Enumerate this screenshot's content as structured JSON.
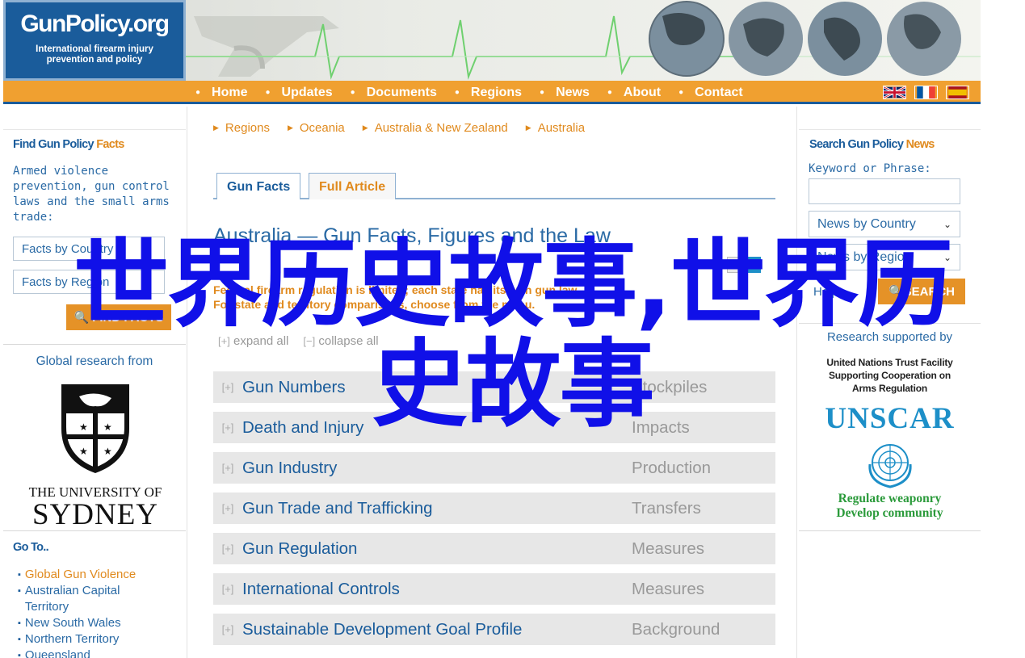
{
  "header": {
    "logo_title": "GunPolicy.org",
    "logo_tagline_1": "International firearm injury",
    "logo_tagline_2": "prevention and policy"
  },
  "nav": {
    "items": [
      "Home",
      "Updates",
      "Documents",
      "Regions",
      "News",
      "About",
      "Contact"
    ],
    "flags": [
      "uk-flag-icon",
      "france-flag-icon",
      "spain-flag-icon"
    ]
  },
  "left": {
    "find_heading_a": "Find Gun Policy",
    "find_heading_b": "Facts",
    "find_desc": "Armed violence prevention, gun control laws and the small arms trade:",
    "select_country": "Facts by Country",
    "select_region": "Facts by Region",
    "find_button": "FIND FACTS",
    "global_label": "Global research from",
    "usyd_line1": "THE UNIVERSITY OF",
    "usyd_line2": "SYDNEY",
    "goto_heading": "Go To..",
    "goto_items": [
      "Global Gun Violence",
      "Australian Capital Territory",
      "New South Wales",
      "Northern Territory",
      "Queensland"
    ]
  },
  "center": {
    "breadcrumb": [
      "Regions",
      "Oceania",
      "Australia & New Zealand",
      "Australia"
    ],
    "tabs": [
      "Gun Facts",
      "Full Article"
    ],
    "title": "Australia — Gun Facts, Figures and the Law",
    "warning_1": "Federal firearm regulation is limited; each state has its own gun law.",
    "warning_2": "For state and territory comparisons, choose from the menu.",
    "expand_all": "expand all",
    "collapse_all": "collapse all",
    "facts": [
      {
        "title": "Gun Numbers",
        "sub": "Stockpiles"
      },
      {
        "title": "Death and Injury",
        "sub": "Impacts"
      },
      {
        "title": "Gun Industry",
        "sub": "Production"
      },
      {
        "title": "Gun Trade and Trafficking",
        "sub": "Transfers"
      },
      {
        "title": "Gun Regulation",
        "sub": "Measures"
      },
      {
        "title": "International Controls",
        "sub": "Measures"
      },
      {
        "title": "Sustainable Development Goal Profile",
        "sub": "Background"
      }
    ]
  },
  "right": {
    "search_heading_a": "Search Gun Policy",
    "search_heading_b": "News",
    "kw_label": "Keyword or Phrase:",
    "kw_value": "",
    "select_country": "News by Country",
    "select_region": "News by Region",
    "help_link": "Help",
    "search_button": "SEARCH",
    "support_label": "Research supported by",
    "untf_1": "United Nations Trust Facility",
    "untf_2": "Supporting Cooperation on",
    "untf_3": "Arms Regulation",
    "unscar": "UNSCAR",
    "slogan_1": "Regulate weaponry",
    "slogan_2": "Develop community"
  },
  "overlay": {
    "line1": "世界历史故事,世界历",
    "line2": "史故事"
  },
  "colors": {
    "brand_blue": "#1a5c9b",
    "accent_orange": "#e59227",
    "link_blue": "#2a6aa5",
    "overlay_blue": "#1010e8"
  }
}
